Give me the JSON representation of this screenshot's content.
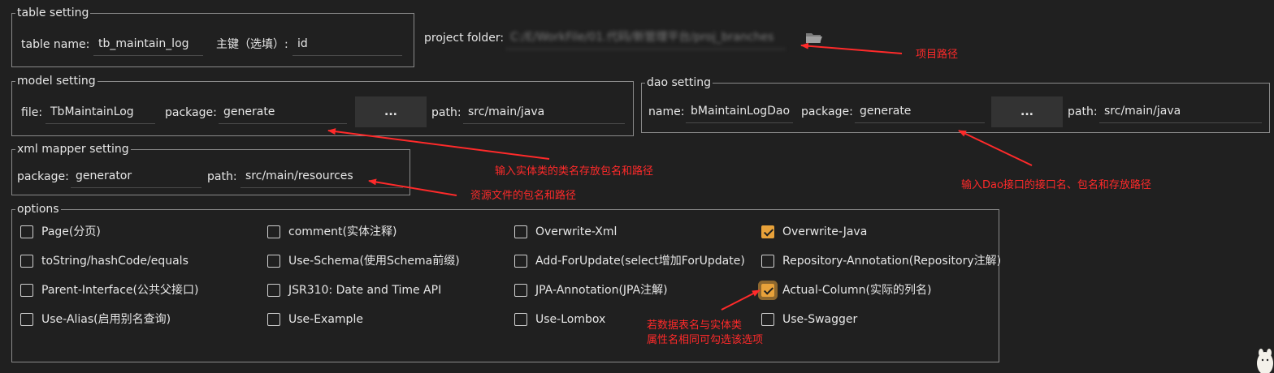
{
  "table_setting": {
    "legend": "table setting",
    "name_label": "table  name:",
    "name_value": "tb_maintain_log",
    "pk_label": "主键（选填）:",
    "pk_value": "id"
  },
  "project": {
    "label": "project folder:",
    "path": "C:/E/WorkFile/01.代码/新管理平台/proj_branches"
  },
  "model_setting": {
    "legend": "model setting",
    "file_label": "file:",
    "file_value": "TbMaintainLog",
    "package_label": "package:",
    "package_value": "generate",
    "browse_label": "...",
    "path_label": "path:",
    "path_value": "src/main/java"
  },
  "dao_setting": {
    "legend": "dao setting",
    "name_label": "name:",
    "name_value": "bMaintainLogDao",
    "package_label": "package:",
    "package_value": "generate",
    "browse_label": "...",
    "path_label": "path:",
    "path_value": "src/main/java"
  },
  "xml_setting": {
    "legend": "xml mapper setting",
    "package_label": "package:",
    "package_value": "generator",
    "path_label": "path:",
    "path_value": "src/main/resources"
  },
  "options": {
    "legend": "options",
    "columns": [
      [
        {
          "label": "Page(分页)",
          "checked": false
        },
        {
          "label": "toString/hashCode/equals",
          "checked": false
        },
        {
          "label": "Parent-Interface(公共父接口)",
          "checked": false
        },
        {
          "label": "Use-Alias(启用别名查询)",
          "checked": false
        }
      ],
      [
        {
          "label": "comment(实体注释)",
          "checked": false
        },
        {
          "label": "Use-Schema(使用Schema前缀)",
          "checked": false
        },
        {
          "label": "JSR310: Date and Time API",
          "checked": false
        },
        {
          "label": "Use-Example",
          "checked": false
        }
      ],
      [
        {
          "label": "Overwrite-Xml",
          "checked": false
        },
        {
          "label": "Add-ForUpdate(select增加ForUpdate)",
          "checked": false
        },
        {
          "label": "JPA-Annotation(JPA注解)",
          "checked": false
        },
        {
          "label": "Use-Lombox",
          "checked": false
        }
      ],
      [
        {
          "label": "Overwrite-Java",
          "checked": true
        },
        {
          "label": "Repository-Annotation(Repository注解)",
          "checked": false
        },
        {
          "label": "Actual-Column(实际的列名)",
          "checked": true
        },
        {
          "label": "Use-Swagger",
          "checked": false
        }
      ]
    ]
  },
  "annotations": {
    "project_path": "项目路径",
    "model": "输入实体类的类名存放包名和路径",
    "dao": "输入Dao接口的接口名、包名和存放路径",
    "xml": "资源文件的包名和路径",
    "column_line1": "若数据表名与实体类",
    "column_line2": "属性名相同可勾选该选项"
  },
  "colors": {
    "background": "#202020",
    "accent": "#e8a23a",
    "annotation": "#ff2a2a"
  },
  "icons": [
    "folder-icon",
    "checkbox-icon",
    "checkmark-icon",
    "mascot-icon"
  ]
}
